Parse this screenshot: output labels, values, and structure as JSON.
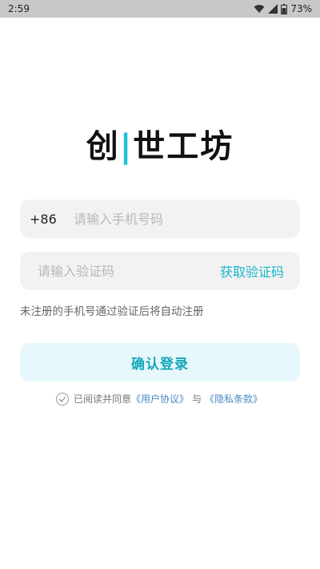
{
  "status": {
    "time": "2:59",
    "battery": "73%"
  },
  "logo": {
    "char1": "创",
    "rest": "世工坊"
  },
  "phone": {
    "prefix": "+86",
    "placeholder": "请输入手机号码"
  },
  "code": {
    "placeholder": "请输入验证码",
    "get_code_label": "获取验证码"
  },
  "hint": "未注册的手机号通过验证后将自动注册",
  "confirm_label": "确认登录",
  "agreement": {
    "prefix": "已阅读并同意",
    "user_agreement": "《用户协议》",
    "and": "与",
    "privacy": "《隐私条款》"
  },
  "colors": {
    "accent": "#1ec3d8",
    "link": "#4a87c8"
  }
}
